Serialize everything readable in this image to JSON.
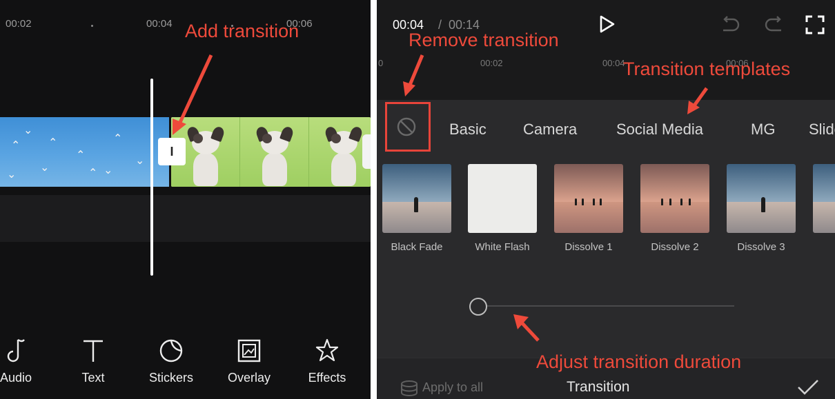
{
  "left": {
    "ruler": [
      "00:02",
      "00:04",
      "00:06"
    ],
    "transition_glyph": "I",
    "toolbar": [
      {
        "label": "Audio",
        "icon": "music-note-icon"
      },
      {
        "label": "Text",
        "icon": "text-icon"
      },
      {
        "label": "Stickers",
        "icon": "sticker-icon"
      },
      {
        "label": "Overlay",
        "icon": "overlay-icon"
      },
      {
        "label": "Effects",
        "icon": "effects-star-icon"
      }
    ]
  },
  "right": {
    "time_current": "00:04",
    "time_separator": "/",
    "time_total": "00:14",
    "mini_ruler": [
      "0",
      "00:02",
      "00:04",
      "00:06"
    ],
    "categories": [
      "Basic",
      "Camera",
      "Social Media",
      "MG",
      "Slide"
    ],
    "templates": [
      {
        "label": "Black Fade",
        "style": "sea"
      },
      {
        "label": "White Flash",
        "style": "white"
      },
      {
        "label": "Dissolve 1",
        "style": "sunset"
      },
      {
        "label": "Dissolve 2",
        "style": "sunset"
      },
      {
        "label": "Dissolve 3",
        "style": "sea"
      },
      {
        "label": "",
        "style": "sea"
      }
    ],
    "duration_fraction": 0.0,
    "apply_all": "Apply to all",
    "sheet_title": "Transition"
  },
  "annotations": {
    "add_transition": "Add transition",
    "remove_transition": "Remove transition",
    "transition_templates": "Transition templates",
    "adjust_duration": "Adjust transition duration"
  },
  "colors": {
    "annotation": "#ee4a3b",
    "background": "#111112",
    "sheet": "#2a2a2c"
  }
}
